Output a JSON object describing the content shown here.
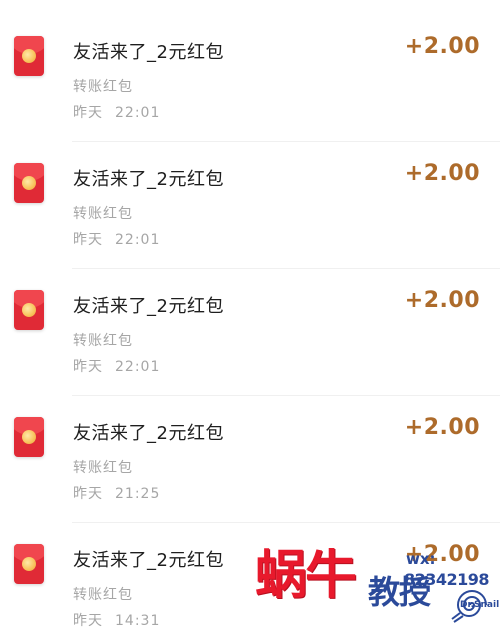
{
  "transactions": [
    {
      "icon": "red-packet-icon",
      "title": "友活来了_2元红包",
      "subtitle": "转账红包",
      "date": "昨天",
      "time": "22:01",
      "amount": "+2.00"
    },
    {
      "icon": "red-packet-icon",
      "title": "友活来了_2元红包",
      "subtitle": "转账红包",
      "date": "昨天",
      "time": "22:01",
      "amount": "+2.00"
    },
    {
      "icon": "red-packet-icon",
      "title": "友活来了_2元红包",
      "subtitle": "转账红包",
      "date": "昨天",
      "time": "22:01",
      "amount": "+2.00"
    },
    {
      "icon": "red-packet-icon",
      "title": "友活来了_2元红包",
      "subtitle": "转账红包",
      "date": "昨天",
      "time": "21:25",
      "amount": "+2.00"
    },
    {
      "icon": "red-packet-icon",
      "title": "友活来了_2元红包",
      "subtitle": "转账红包",
      "date": "昨天",
      "time": "14:31",
      "amount": "+2.00"
    }
  ],
  "watermark": {
    "brand": "蜗牛",
    "sub": "教授",
    "contact_label": "wx:",
    "contact_number": "82342198",
    "english": "Dr.Snail"
  },
  "colors": {
    "amount": "#ad6b2b",
    "red_packet": "#e02a36",
    "watermark_red": "#e8192c",
    "watermark_blue": "#2b4a9a"
  }
}
